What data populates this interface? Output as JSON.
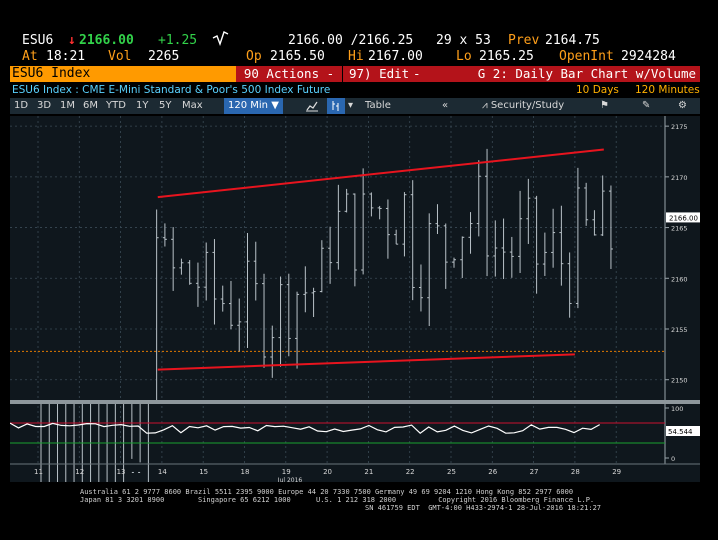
{
  "header": {
    "ticker": "ESU6",
    "arrow": "↓",
    "last": "2166.00",
    "change": "+1.25",
    "bid_ask": "2166.00 /2166.25",
    "size": "29 x 53",
    "prev_label": "Prev",
    "prev_value": "2164.75",
    "at_label": "At",
    "time": "18:21",
    "vol_label": "Vol",
    "vol": "2265",
    "op_label": "Op",
    "op": "2165.50",
    "hi_label": "Hi",
    "hi": "2167.00",
    "lo_label": "Lo",
    "lo": "2165.25",
    "oi_label": "OpenInt",
    "oi": "2924284"
  },
  "function_bar": {
    "security": "ESU6 Index",
    "actions_label": "90 Actions -",
    "edit_label": "97) Edit",
    "edit_arrow": "-",
    "chart_title": "G 2: Daily Bar Chart w/Volume"
  },
  "subtitle": {
    "description": "ESU6 Index : CME E-Mini Standard & Poor's 500 Index Future",
    "days": "10 Days",
    "interval": "120 Minutes"
  },
  "toolbar": {
    "ranges": [
      "1D",
      "3D",
      "1M",
      "6M",
      "YTD",
      "1Y",
      "5Y",
      "Max"
    ],
    "interval_select": "120 Min ▼",
    "table_label": "Table",
    "back_label": "«",
    "security_study_label": "Security/Study"
  },
  "colors": {
    "price_bars": "#b9c2c8",
    "trendline": "#e8141e",
    "support": "#e07a00",
    "oscillator": "#ffffff",
    "chart_bg": "#0f171d"
  },
  "chart_data": {
    "type": "bar",
    "xlabel": "",
    "ylabel": "",
    "dates": [
      "11",
      "12",
      "13",
      "14",
      "15",
      "18",
      "19",
      "20",
      "21",
      "22",
      "25",
      "26",
      "27",
      "28",
      "29"
    ],
    "month_label": "Jul 2016",
    "y_ticks": [
      "2175",
      "2170",
      "2165",
      "2160",
      "2155",
      "2150"
    ],
    "ylim": [
      2148,
      2176
    ],
    "last_price_label": "2166.00",
    "oscillator_ticks": [
      "100",
      "0"
    ],
    "oscillator_value_label": "54.544",
    "trend_upper": {
      "start": [
        3.9,
        2168.0
      ],
      "end": [
        14.7,
        2172.7
      ]
    },
    "trend_lower": {
      "start": [
        3.9,
        2151.0
      ],
      "end": [
        14.0,
        2152.5
      ]
    },
    "support_level": 2152.8
  },
  "footer": {
    "line1": "Australia 61 2 9777 8600 Brazil 5511 2395 9000 Europe 44 20 7330 7500 Germany 49 69 9204 1210 Hong Kong 852 2977 6000",
    "line2": "Japan 81 3 3201 8900        Singapore 65 6212 1000      U.S. 1 212 318 2000          Copyright 2016 Bloomberg Finance L.P.",
    "line3": "SN 461759 EDT  GMT-4:00 H433-2974-1 28-Jul-2016 18:21:27"
  }
}
